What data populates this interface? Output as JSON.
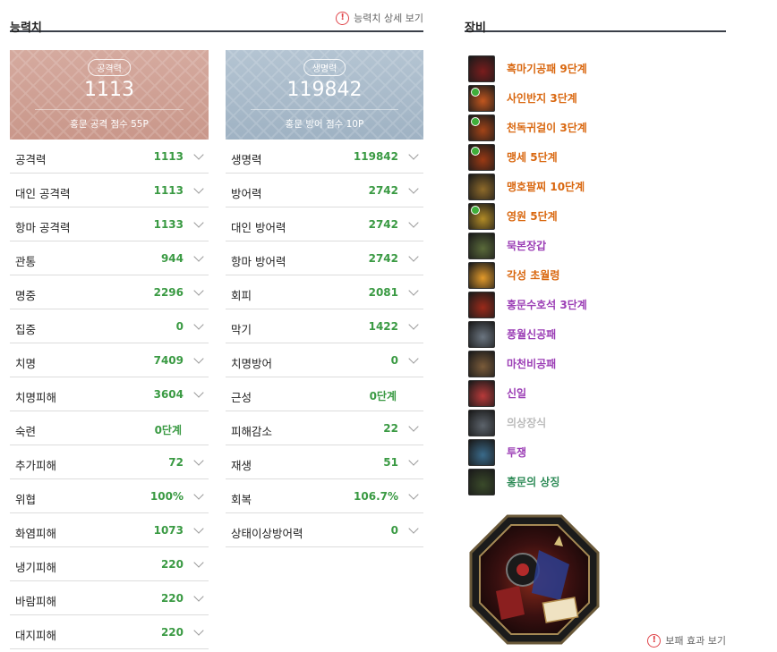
{
  "stats": {
    "title": "능력치",
    "detail_link": "능력치 상세 보기",
    "attack_card": {
      "badge": "공격력",
      "value": "1113",
      "footer": "홍문 공격 점수 55P"
    },
    "defense_card": {
      "badge": "생명력",
      "value": "119842",
      "footer": "홍문 방어 점수 10P"
    },
    "left": [
      {
        "label": "공격력",
        "value": "1113",
        "expand": true
      },
      {
        "label": "대인 공격력",
        "value": "1113",
        "expand": true
      },
      {
        "label": "항마 공격력",
        "value": "1133",
        "expand": true
      },
      {
        "label": "관통",
        "value": "944",
        "expand": true
      },
      {
        "label": "명중",
        "value": "2296",
        "expand": true
      },
      {
        "label": "집중",
        "value": "0",
        "expand": true
      },
      {
        "label": "치명",
        "value": "7409",
        "expand": true
      },
      {
        "label": "치명피해",
        "value": "3604",
        "expand": true
      },
      {
        "label": "숙련",
        "value": "0단계",
        "expand": false
      },
      {
        "label": "추가피해",
        "value": "72",
        "expand": true
      },
      {
        "label": "위협",
        "value": "100%",
        "expand": true
      },
      {
        "label": "화염피해",
        "value": "1073",
        "expand": true
      },
      {
        "label": "냉기피해",
        "value": "220",
        "expand": true
      },
      {
        "label": "바람피해",
        "value": "220",
        "expand": true
      },
      {
        "label": "대지피해",
        "value": "220",
        "expand": true
      }
    ],
    "right": [
      {
        "label": "생명력",
        "value": "119842",
        "expand": true
      },
      {
        "label": "방어력",
        "value": "2742",
        "expand": true
      },
      {
        "label": "대인 방어력",
        "value": "2742",
        "expand": true
      },
      {
        "label": "항마 방어력",
        "value": "2742",
        "expand": true
      },
      {
        "label": "회피",
        "value": "2081",
        "expand": true
      },
      {
        "label": "막기",
        "value": "1422",
        "expand": true
      },
      {
        "label": "치명방어",
        "value": "0",
        "expand": true
      },
      {
        "label": "근성",
        "value": "0단계",
        "expand": false
      },
      {
        "label": "피해감소",
        "value": "22",
        "expand": true
      },
      {
        "label": "재생",
        "value": "51",
        "expand": true
      },
      {
        "label": "회복",
        "value": "106.7%",
        "expand": true
      },
      {
        "label": "상태이상방어력",
        "value": "0",
        "expand": true
      }
    ]
  },
  "equipment": {
    "title": "장비",
    "treasure_link": "보패 효과 보기",
    "items": [
      {
        "name": "흑마기공패 9단계",
        "color": "#d9670f",
        "icon_color": "#7a1d1d",
        "gem": false
      },
      {
        "name": "사인반지 3단계",
        "color": "#d9670f",
        "icon_color": "#c2561e",
        "gem": true
      },
      {
        "name": "천독귀걸이 3단계",
        "color": "#d9670f",
        "icon_color": "#a34418",
        "gem": true
      },
      {
        "name": "맹세 5단계",
        "color": "#d9670f",
        "icon_color": "#9b3a14",
        "gem": true
      },
      {
        "name": "맹호팔찌 10단계",
        "color": "#d9670f",
        "icon_color": "#8e6a2a",
        "gem": false
      },
      {
        "name": "영원 5단계",
        "color": "#d9670f",
        "icon_color": "#b28b26",
        "gem": true
      },
      {
        "name": "묵본장갑",
        "color": "#9b3db5",
        "icon_color": "#5a6a3a",
        "gem": false
      },
      {
        "name": "각성 초월령",
        "color": "#d9670f",
        "icon_color": "#e39a2a",
        "gem": false
      },
      {
        "name": "홍문수호석 3단계",
        "color": "#9b3db5",
        "icon_color": "#9b2a1a",
        "gem": false
      },
      {
        "name": "풍월신공패",
        "color": "#9b3db5",
        "icon_color": "#6b7580",
        "gem": false
      },
      {
        "name": "마천비공패",
        "color": "#9b3db5",
        "icon_color": "#7a5b3a",
        "gem": false
      },
      {
        "name": "신일",
        "color": "#9b3db5",
        "icon_color": "#b83a3a",
        "gem": false
      },
      {
        "name": "의상장식",
        "color": "#bbbbbb",
        "icon_color": "#5c636b",
        "gem": false
      },
      {
        "name": "투쟁",
        "color": "#9b3db5",
        "icon_color": "#3a6a8a",
        "gem": false
      },
      {
        "name": "홍문의 상징",
        "color": "#2e8b57",
        "icon_color": "#3a4a2a",
        "gem": false
      }
    ]
  }
}
